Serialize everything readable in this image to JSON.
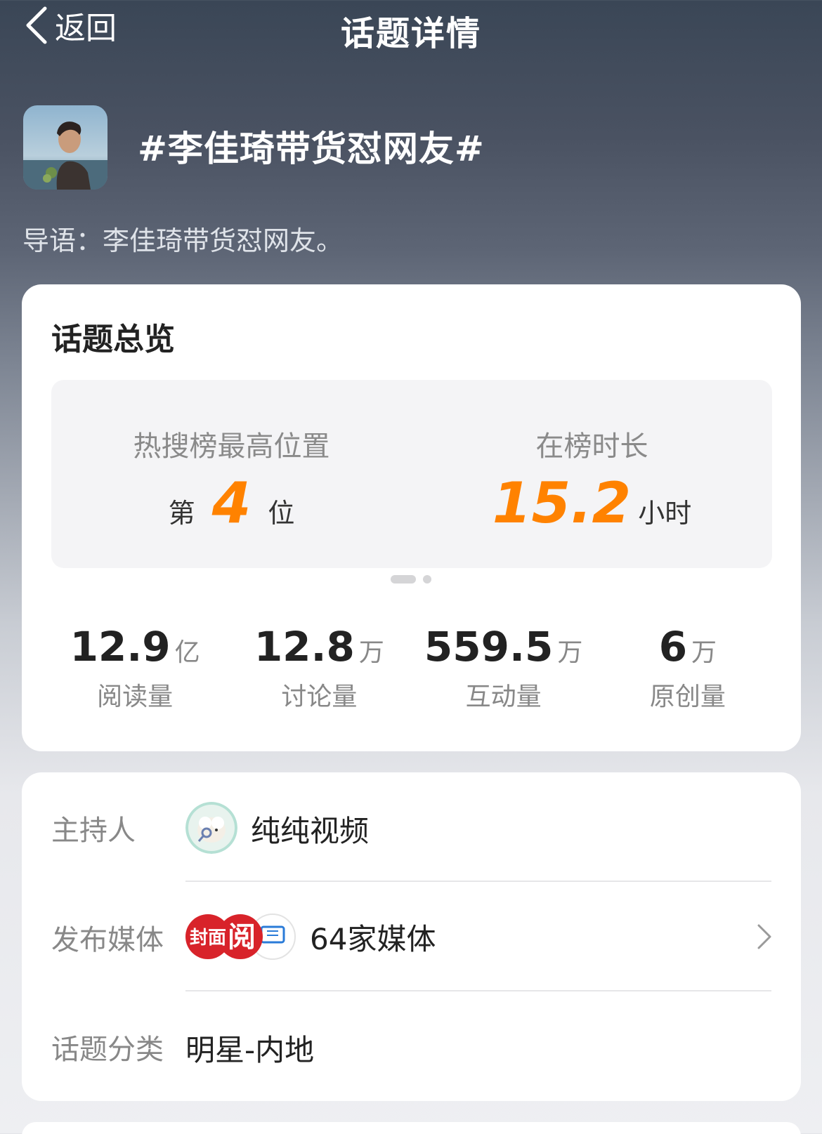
{
  "header": {
    "back_label": "返回",
    "title": "话题详情"
  },
  "topic": {
    "title": "#李佳琦带货怼网友#",
    "intro": "导语：李佳琦带货怼网友。"
  },
  "overview": {
    "heading": "话题总览",
    "rank": {
      "label": "热搜榜最高位置",
      "prefix": "第",
      "value": "4",
      "suffix": "位"
    },
    "duration": {
      "label": "在榜时长",
      "value": "15.2",
      "unit": "小时"
    },
    "stats": [
      {
        "value": "12.9",
        "unit": "亿",
        "label": "阅读量"
      },
      {
        "value": "12.8",
        "unit": "万",
        "label": "讨论量"
      },
      {
        "value": "559.5",
        "unit": "万",
        "label": "互动量"
      },
      {
        "value": "6",
        "unit": "万",
        "label": "原创量"
      }
    ]
  },
  "info": {
    "host_label": "主持人",
    "host_name": "纯纯视频",
    "media_label": "发布媒体",
    "media_count": "64家媒体",
    "media_logo_1_text": "封面",
    "media_logo_2_text": "阅",
    "category_label": "话题分类",
    "category_value": "明星-内地"
  },
  "colors": {
    "accent": "#ff8200"
  }
}
